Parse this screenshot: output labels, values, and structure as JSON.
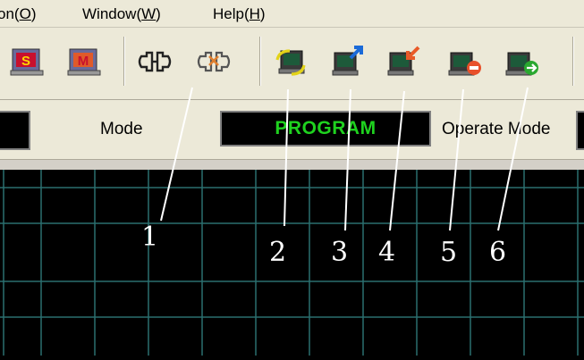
{
  "menubar": {
    "items": [
      {
        "label": "on(",
        "key": "O",
        "suffix": ")"
      },
      {
        "label": "Window(",
        "key": "W",
        "suffix": ")"
      },
      {
        "label": "Help(",
        "key": "H",
        "suffix": ")"
      }
    ]
  },
  "toolbar": {
    "buttons": [
      {
        "name": "s-icon",
        "letter": "S"
      },
      {
        "name": "m-icon",
        "letter": "M"
      },
      {
        "name": "connect-icon"
      },
      {
        "name": "disconnect-icon"
      },
      {
        "name": "sync-icon"
      },
      {
        "name": "upload-icon"
      },
      {
        "name": "download-icon"
      },
      {
        "name": "stop-icon"
      },
      {
        "name": "run-icon"
      }
    ]
  },
  "status": {
    "mode_label": "Mode",
    "mode_value": "PROGRAM",
    "operate_label": "Operate Mode"
  },
  "callouts": [
    "1",
    "2",
    "3",
    "4",
    "5",
    "6"
  ],
  "colors": {
    "mode_text": "#1fd21f",
    "grid_line": "#2a6f6f",
    "border_line": "#1e8c1e"
  }
}
